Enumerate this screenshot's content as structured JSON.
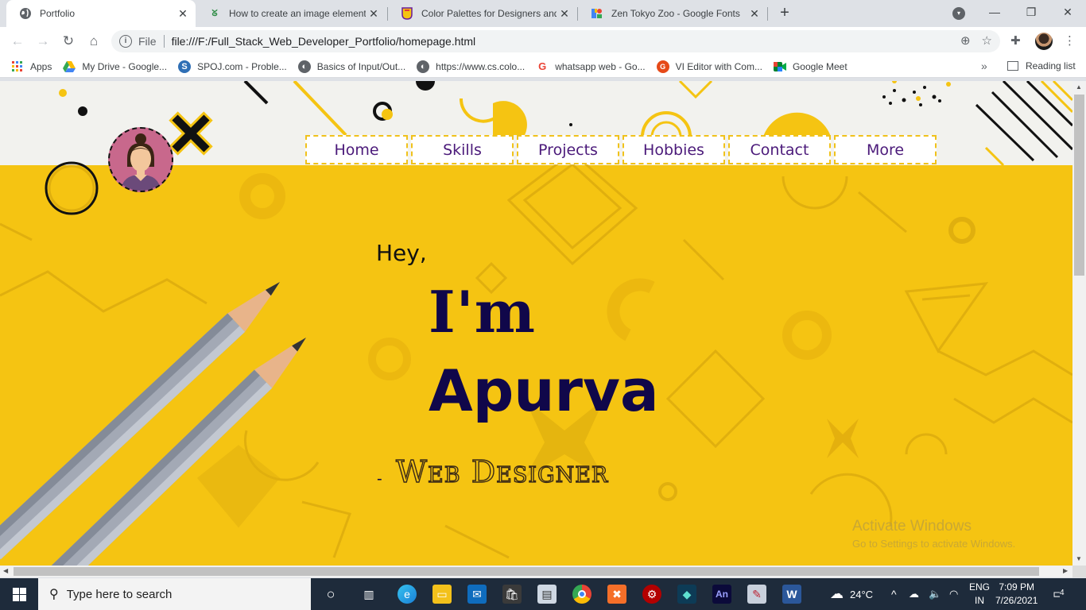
{
  "browser": {
    "tabs": [
      {
        "title": "Portfolio",
        "active": true
      },
      {
        "title": "How to create an image element",
        "active": false
      },
      {
        "title": "Color Palettes for Designers and",
        "active": false
      },
      {
        "title": "Zen Tokyo Zoo - Google Fonts",
        "active": false
      }
    ],
    "address": {
      "scheme_label": "File",
      "url": "file:///F:/Full_Stack_Web_Developer_Portfolio/homepage.html"
    },
    "bookmarks": [
      {
        "label": "Apps",
        "icon": "apps-grid-icon"
      },
      {
        "label": "My Drive - Google...",
        "icon": "google-drive-icon"
      },
      {
        "label": "SPOJ.com - Proble...",
        "icon": "spoj-icon"
      },
      {
        "label": "Basics of Input/Out...",
        "icon": "globe-icon"
      },
      {
        "label": "https://www.cs.colo...",
        "icon": "globe-icon"
      },
      {
        "label": "whatsapp web - Go...",
        "icon": "google-g-icon"
      },
      {
        "label": "VI Editor with Com...",
        "icon": "vi-editor-icon"
      },
      {
        "label": "Google Meet",
        "icon": "google-meet-icon"
      }
    ],
    "reading_list": "Reading list"
  },
  "page": {
    "nav": [
      "Home",
      "Skills",
      "Projects",
      "Hobbies",
      "Contact",
      "More"
    ],
    "greeting": "Hey,",
    "im": "I'm",
    "name": "Apurva",
    "role_dash": "-",
    "role": "Web Designer",
    "watermark": {
      "title": "Activate Windows",
      "subtitle": "Go to Settings to activate Windows."
    },
    "colors": {
      "primary": "#f5c412",
      "text": "#10074a",
      "nav_text": "#4b1a7a"
    }
  },
  "taskbar": {
    "search_placeholder": "Type here to search",
    "weather": "24°C",
    "language": [
      "ENG",
      "IN"
    ],
    "time": "7:09 PM",
    "date": "7/26/2021",
    "notifications": "4"
  }
}
